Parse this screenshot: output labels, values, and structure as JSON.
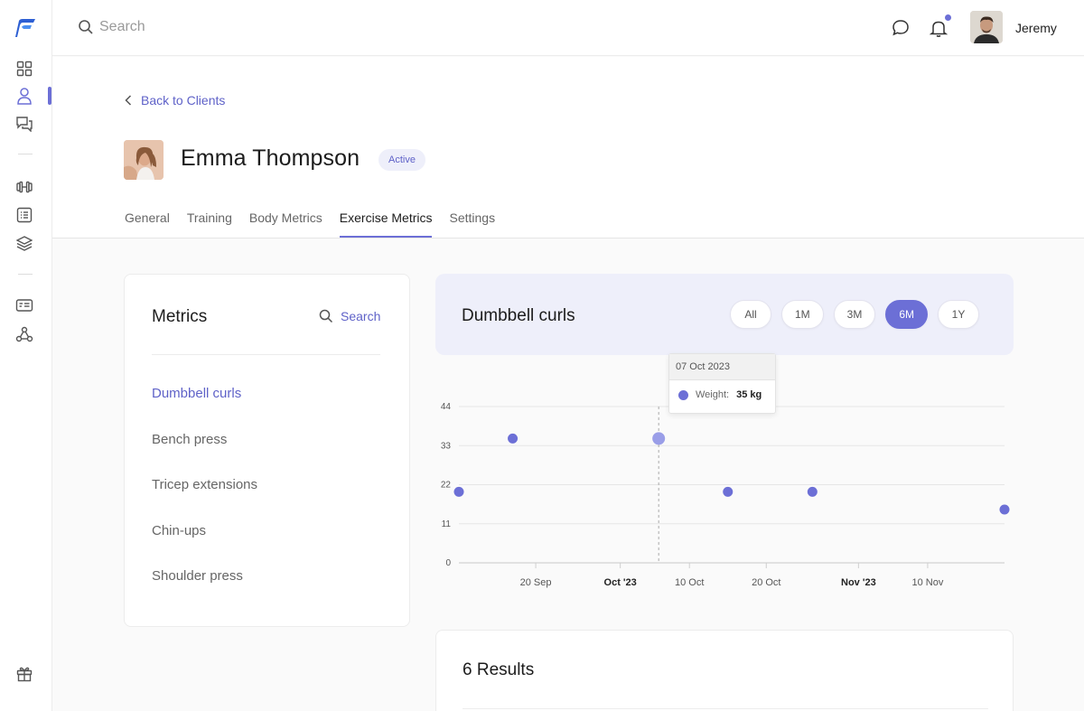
{
  "topbar": {
    "search_placeholder": "Search",
    "user_name": "Jeremy",
    "icons": [
      "search-icon",
      "chat-icon",
      "bell-icon"
    ]
  },
  "sidebar": {
    "icons": [
      "logo-icon",
      "dashboard-icon",
      "user-icon",
      "messages-icon",
      "dumbbell-icon",
      "list-icon",
      "layers-icon",
      "id-card-icon",
      "webhook-icon",
      "gift-icon"
    ],
    "active": "user-icon"
  },
  "header": {
    "back_label": "Back to Clients",
    "client_name": "Emma Thompson",
    "status": "Active",
    "tabs": [
      {
        "label": "General"
      },
      {
        "label": "Training"
      },
      {
        "label": "Body Metrics"
      },
      {
        "label": "Exercise Metrics"
      },
      {
        "label": "Settings"
      }
    ],
    "active_tab": "Exercise Metrics"
  },
  "metrics": {
    "title": "Metrics",
    "search_label": "Search",
    "items": [
      {
        "label": "Dumbbell curls"
      },
      {
        "label": "Bench press"
      },
      {
        "label": "Tricep extensions"
      },
      {
        "label": "Chin-ups"
      },
      {
        "label": "Shoulder press"
      }
    ],
    "active_item": "Dumbbell curls"
  },
  "chart_panel": {
    "title": "Dumbbell curls",
    "ranges": [
      "All",
      "1M",
      "3M",
      "6M",
      "1Y"
    ],
    "active_range": "6M",
    "tooltip": {
      "date": "07 Oct 2023",
      "label": "Weight:",
      "value": "35 kg"
    }
  },
  "chart_data": {
    "type": "scatter",
    "title": "",
    "xlabel": "",
    "ylabel": "",
    "y_ticks": [
      "0",
      "11",
      "22",
      "33",
      "44"
    ],
    "ylim": [
      0,
      44
    ],
    "x_ticks": [
      {
        "label": "20 Sep",
        "bold": false
      },
      {
        "label": "Oct '23",
        "bold": true
      },
      {
        "label": "10 Oct",
        "bold": false
      },
      {
        "label": "20 Oct",
        "bold": false
      },
      {
        "label": "Nov '23",
        "bold": true
      },
      {
        "label": "10 Nov",
        "bold": false
      }
    ],
    "x_tick_dates": [
      "2023-09-20",
      "2023-10-01",
      "2023-10-10",
      "2023-10-20",
      "2023-11-01",
      "2023-11-10"
    ],
    "xlim": [
      "2023-09-10",
      "2023-11-20"
    ],
    "series": [
      {
        "points": [
          {
            "date": "2023-09-10",
            "y": 20
          },
          {
            "date": "2023-09-17",
            "y": 35
          },
          {
            "date": "2023-10-06",
            "y": 35
          },
          {
            "date": "2023-10-15",
            "y": 20
          },
          {
            "date": "2023-10-26",
            "y": 20
          },
          {
            "date": "2023-11-20",
            "y": 15
          }
        ]
      }
    ],
    "highlight_date": "2023-10-06",
    "grid": true,
    "color": "#6c6fd6",
    "highlight_color": "#9a9ee8"
  },
  "results": {
    "title": "6 Results"
  },
  "colors": {
    "accent": "#6c6fd6",
    "accent_light": "#eeeffa"
  }
}
